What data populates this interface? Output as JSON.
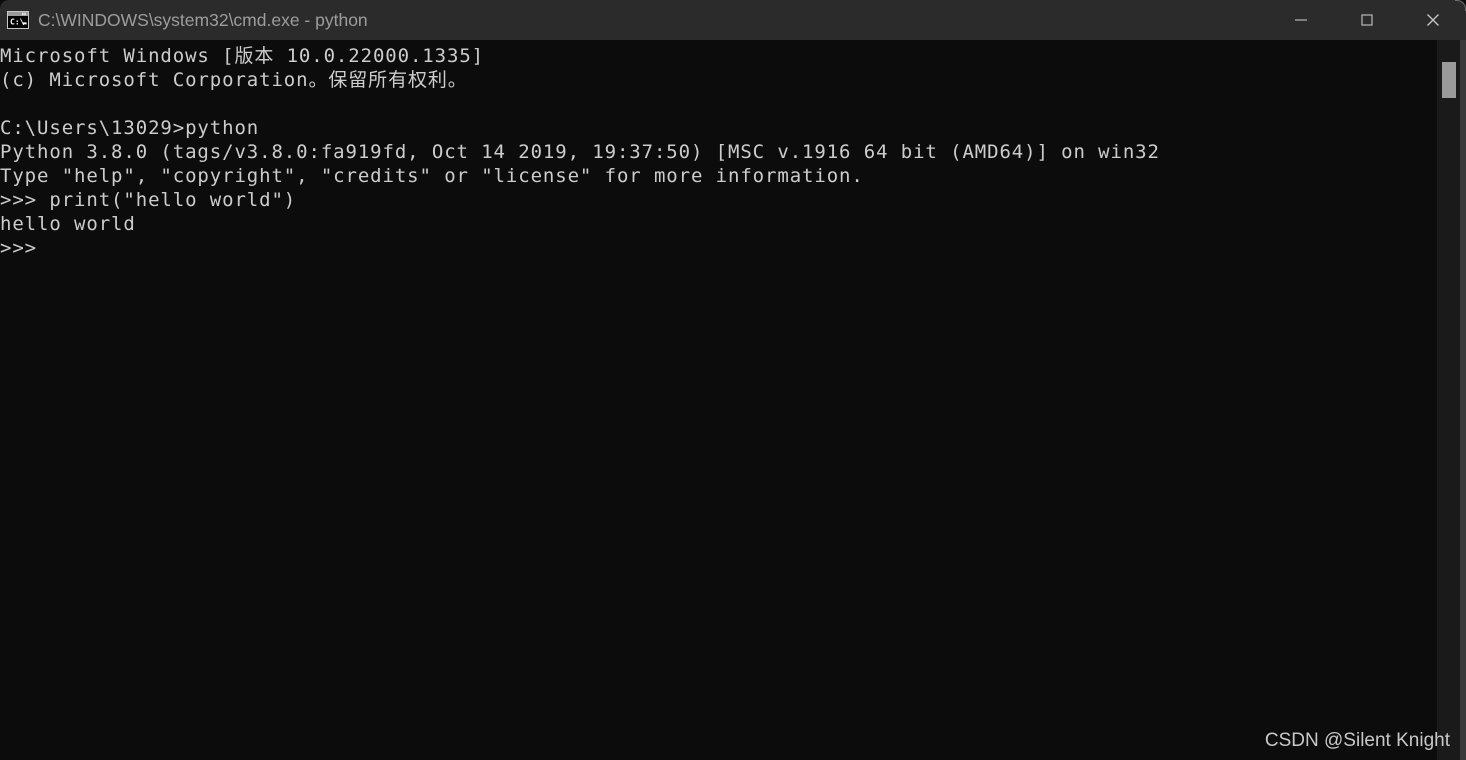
{
  "window": {
    "title": "C:\\WINDOWS\\system32\\cmd.exe - python",
    "icon": "cmd-console-icon",
    "titlebar_color": "#2b2b2b",
    "title_text_color": "#9d9d9d",
    "background_color": "#0c0c0c",
    "text_color": "#cccccc"
  },
  "caption_buttons": [
    {
      "name": "minimize",
      "glyph": "—",
      "label": "Minimize"
    },
    {
      "name": "maximize",
      "glyph": "□",
      "label": "Maximize"
    },
    {
      "name": "close",
      "glyph": "✕",
      "label": "Close"
    }
  ],
  "console": {
    "lines": [
      "Microsoft Windows [版本 10.0.22000.1335]",
      "(c) Microsoft Corporation。保留所有权利。",
      "",
      "C:\\Users\\13029>python",
      "Python 3.8.0 (tags/v3.8.0:fa919fd, Oct 14 2019, 19:37:50) [MSC v.1916 64 bit (AMD64)] on win32",
      "Type \"help\", \"copyright\", \"credits\" or \"license\" for more information.",
      ">>> print(\"hello world\")",
      "hello world",
      ">>> "
    ],
    "text": "Microsoft Windows [版本 10.0.22000.1335]\n(c) Microsoft Corporation。保留所有权利。\n\nC:\\Users\\13029>python\nPython 3.8.0 (tags/v3.8.0:fa919fd, Oct 14 2019, 19:37:50) [MSC v.1916 64 bit (AMD64)] on win32\nType \"help\", \"copyright\", \"credits\" or \"license\" for more information.\n>>> print(\"hello world\")\nhello world\n>>> ",
    "command_entered": "python",
    "current_prompt": ">>>",
    "python_version": "3.8.0",
    "python_build": "tags/v3.8.0:fa919fd",
    "python_build_date": "Oct 14 2019, 19:37:50",
    "python_compiler": "[MSC v.1916 64 bit (AMD64)] on win32",
    "windows_version": "10.0.22000.1335",
    "working_directory": "C:\\Users\\13029",
    "program_output": "hello world"
  },
  "scrollbar": {
    "track_color": "#1a1a1a",
    "thumb_color": "#9a9a9a",
    "thumb_top_percent": 3,
    "thumb_height_percent": 5
  },
  "watermark": {
    "text": "CSDN @Silent Knight"
  }
}
